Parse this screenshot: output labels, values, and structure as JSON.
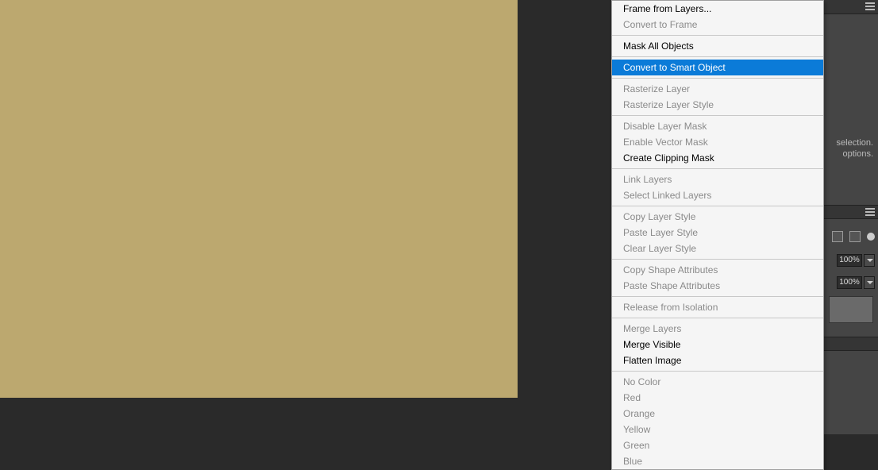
{
  "menu": {
    "items": [
      {
        "label": "Frame from Layers...",
        "disabled": false,
        "highlighted": false
      },
      {
        "label": "Convert to Frame",
        "disabled": true,
        "highlighted": false
      },
      "sep",
      {
        "label": "Mask All Objects",
        "disabled": false,
        "highlighted": false
      },
      "sep",
      {
        "label": "Convert to Smart Object",
        "disabled": false,
        "highlighted": true
      },
      "sep",
      {
        "label": "Rasterize Layer",
        "disabled": true,
        "highlighted": false
      },
      {
        "label": "Rasterize Layer Style",
        "disabled": true,
        "highlighted": false
      },
      "sep",
      {
        "label": "Disable Layer Mask",
        "disabled": true,
        "highlighted": false
      },
      {
        "label": "Enable Vector Mask",
        "disabled": true,
        "highlighted": false
      },
      {
        "label": "Create Clipping Mask",
        "disabled": false,
        "highlighted": false
      },
      "sep",
      {
        "label": "Link Layers",
        "disabled": true,
        "highlighted": false
      },
      {
        "label": "Select Linked Layers",
        "disabled": true,
        "highlighted": false
      },
      "sep",
      {
        "label": "Copy Layer Style",
        "disabled": true,
        "highlighted": false
      },
      {
        "label": "Paste Layer Style",
        "disabled": true,
        "highlighted": false
      },
      {
        "label": "Clear Layer Style",
        "disabled": true,
        "highlighted": false
      },
      "sep",
      {
        "label": "Copy Shape Attributes",
        "disabled": true,
        "highlighted": false
      },
      {
        "label": "Paste Shape Attributes",
        "disabled": true,
        "highlighted": false
      },
      "sep",
      {
        "label": "Release from Isolation",
        "disabled": true,
        "highlighted": false
      },
      "sep",
      {
        "label": "Merge Layers",
        "disabled": true,
        "highlighted": false
      },
      {
        "label": "Merge Visible",
        "disabled": false,
        "highlighted": false
      },
      {
        "label": "Flatten Image",
        "disabled": false,
        "highlighted": false
      },
      "sep",
      {
        "label": "No Color",
        "disabled": true,
        "highlighted": false
      },
      {
        "label": "Red",
        "disabled": true,
        "highlighted": false
      },
      {
        "label": "Orange",
        "disabled": true,
        "highlighted": false
      },
      {
        "label": "Yellow",
        "disabled": true,
        "highlighted": false
      },
      {
        "label": "Green",
        "disabled": true,
        "highlighted": false
      },
      {
        "label": "Blue",
        "disabled": true,
        "highlighted": false
      }
    ]
  },
  "side": {
    "hint_line1": "selection.",
    "hint_line2": "options.",
    "pct1": "100%",
    "pct2": "100%"
  },
  "colors": {
    "canvas_fill": "#bca86f",
    "highlight": "#0b7bd8"
  }
}
